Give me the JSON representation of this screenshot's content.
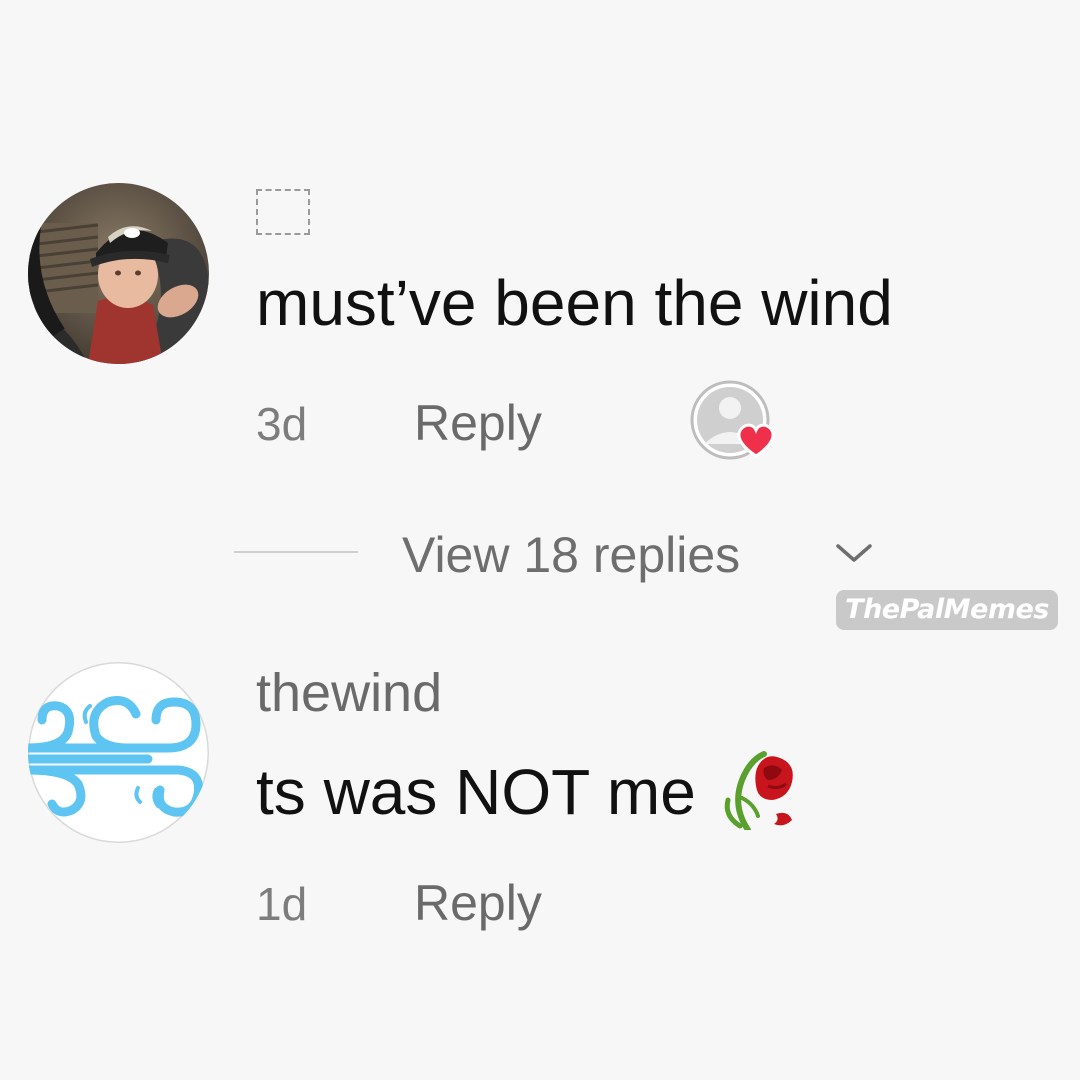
{
  "comments": [
    {
      "username": "",
      "text": "must’ve been the wind",
      "time": "3d",
      "reply_label": "Reply",
      "liked_by_author": true,
      "avatar_icon": "boy-in-cap-photo"
    },
    {
      "username": "thewind",
      "text": "ts was NOT me",
      "emoji_icon": "wilted-flower-icon",
      "time": "1d",
      "reply_label": "Reply",
      "avatar_icon": "wind-icon"
    }
  ],
  "replies_toggle": {
    "label": "View 18 replies",
    "icon": "chevron-down-icon"
  },
  "watermark": {
    "text": "ThePalMemes"
  },
  "colors": {
    "background": "#f7f7f7",
    "text_primary": "#111111",
    "text_secondary": "#6a6a6a",
    "heart": "#f0304a",
    "wind_blue": "#5ec4f2",
    "flower_red": "#c8141c",
    "flower_green": "#5aa02c"
  }
}
